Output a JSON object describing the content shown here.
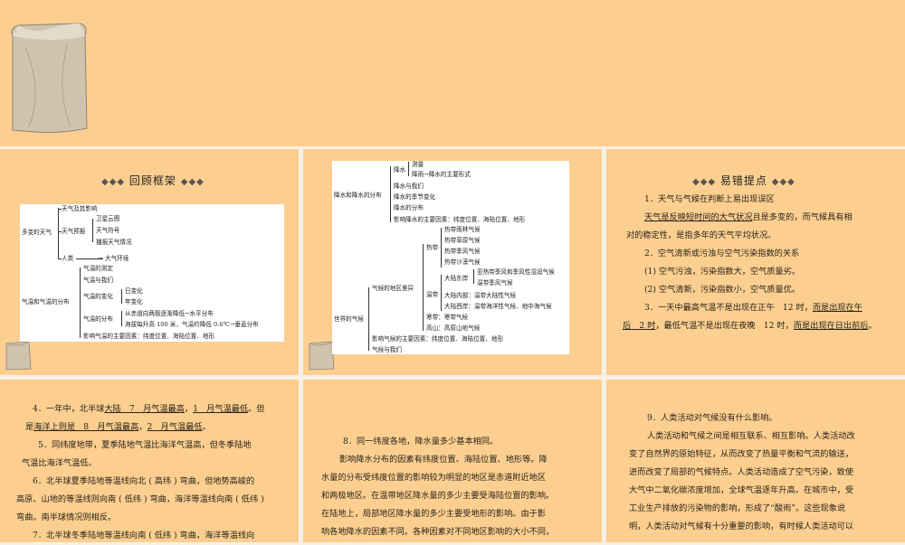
{
  "header1": "回顾框架",
  "header2": "易错提点",
  "diagram1": {
    "root1": "多变的天气",
    "root2": "气温和气温的分布",
    "weather_items": [
      "天气及其影响",
      "天气预报",
      "人类"
    ],
    "forecast_items": [
      "卫星云图",
      "天气符号",
      "播报天气情况"
    ],
    "human_arrow": "大气环境",
    "temp_items": [
      "气温的测定",
      "气温与我们",
      "气温的变化",
      "气温的分布",
      "影响气温的主要因素：纬度位置、海陆位置、地形"
    ],
    "temp_change": [
      "日变化",
      "年变化"
    ],
    "temp_dist": [
      "从赤道向两极逐渐降低→水平分布",
      "海拔每升高 100 米，气温约降低 0.6℃→垂直分布"
    ]
  },
  "diagram2": {
    "root1": "降水和降水的分布",
    "root2": "世界的气候",
    "precip_items": [
      "降水",
      "降水与我们",
      "降水的季节变化",
      "降水的分布",
      "影响降水的主要因素：纬度位置、海陆位置、地形"
    ],
    "precip_sub": [
      "测量",
      "降雨→降水的主要形式"
    ],
    "climate_items": [
      "气候的地区差异",
      "影响气候的主要因素：纬度位置、海陆位置、地形",
      "气候与我们"
    ],
    "zones": [
      "热带",
      "温带",
      "寒带：寒带气候",
      "高山：高原山地气候"
    ],
    "tropical": [
      "热带雨林气候",
      "热带草原气候",
      "热带季风气候",
      "热带沙漠气候"
    ],
    "temperate_groups": [
      "大陆东岸",
      "大陆内部：温带大陆性气候",
      "大陆西岸：温带海洋性气候、地中海气候"
    ],
    "east_coast": [
      "亚热带季风和季风性湿润气候",
      "温带季风气候"
    ]
  },
  "errors_a": {
    "l1": "1．天气与气候在判断上易出现误区",
    "l2a": "天气是反映短时间的大气状况",
    "l2b": "且是多变的，而气候具有相",
    "l3": "对的稳定性，是指多年的天气平均状况。",
    "l4": "2．空气清新或污浊与空气污染指数的关系",
    "l5": "(1) 空气污浊，污染指数大，空气质量劣。",
    "l6": "(2) 空气清新，污染指数小，空气质量优。",
    "l7a": "3．一天中最高气温不是出现在正午　12 时，",
    "l7b": "而是出现在午",
    "l8a": "后　2 时",
    "l8b": "，最低气温不是出现在夜晚　12 时，",
    "l8c": "而是出现在日出前后",
    "l8d": "。"
  },
  "errors_b": {
    "l1a": "4．一年中，北半球",
    "l1b": "大陆　7　月气温最高",
    "l1c": "，",
    "l1d": "1　月气温最低",
    "l1e": "。但",
    "l2a": "是",
    "l2b": "海洋上则是　8　月气温最高",
    "l2c": "，",
    "l2d": "2　月气温最低",
    "l2e": "。",
    "l3": "5．同纬度地带，夏季陆地气温比海洋气温高，但冬季陆地",
    "l4": "气温比海洋气温低。",
    "l5": "6．北半球夏季陆地等温线向北 ( 高纬 ) 弯曲，但地势高峻的",
    "l6": "高原、山地的等温线则向南 ( 低纬 ) 弯曲，海洋等温线向南 ( 低纬 )",
    "l7": "弯曲。南半球情况则相反。",
    "l8": "7．北半球冬季陆地等温线向南 ( 低纬 ) 弯曲，海洋等温线向"
  },
  "errors_c": {
    "l1": "8．同一纬度各地，降水量多少基本相同。",
    "l2": "影响降水分布的因素有纬度位置、海陆位置、地形等。降",
    "l3": "水量的分布受纬度位置的影响较为明显的地区是赤道附近地区",
    "l4": "和两极地区。在温带地区降水量的多少主要受海陆位置的影响。",
    "l5": "在陆地上，局部地区降水量的多少主要受地形的影响。由于影",
    "l6": "响各地降水的因素不同。各种因素对不同地区影响的大小不同，"
  },
  "errors_d": {
    "l1": "9．人类活动对气候没有什么影响。",
    "l2": "人类活动和气候之间是相互联系、相互影响。人类活动改",
    "l3": "变了自然界的原始特征，从而改变了热量平衡和气流的输送，",
    "l4": "进而改变了局部的气候特点。人类活动造成了空气污染，致使",
    "l5": "大气中二氧化碳浓度增加，全球气温逐年升高。在城市中，受",
    "l6": "工业生产排放的污染物的影响，形成了“酸雨”。这些现象说",
    "l7": "明，人类活动对气候有十分重要的影响，有时候人类活动可以"
  }
}
